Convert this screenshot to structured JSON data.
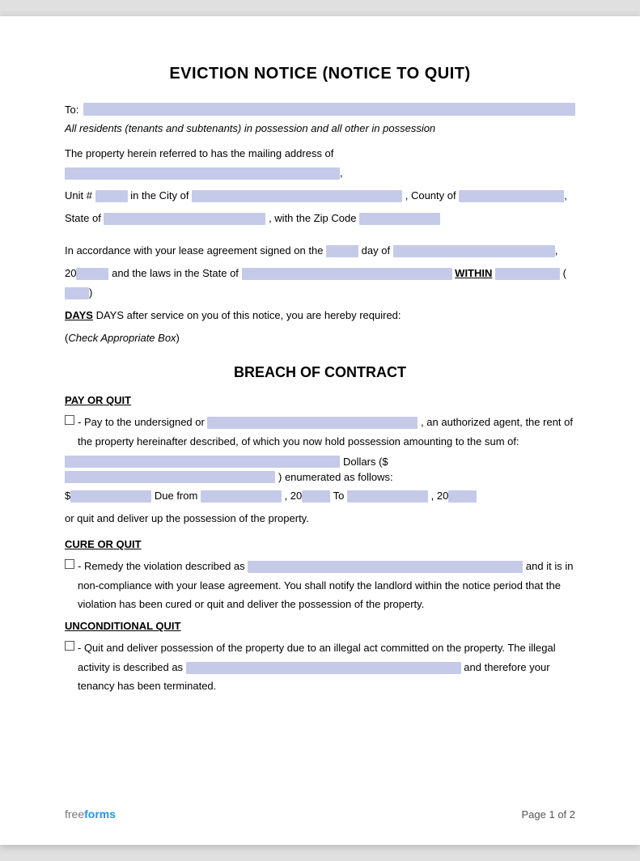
{
  "document": {
    "title": "EVICTION NOTICE (NOTICE TO QUIT)",
    "to_label": "To:",
    "italic_note": "All residents (tenants and subtenants) in possession and all other in possession",
    "address_intro": "The property herein referred to has the mailing address of",
    "unit_label": "Unit #",
    "city_label": "in the City of",
    "county_label": ", County of",
    "state_label": "State of",
    "zip_label": ", with the Zip Code",
    "lease_paragraph_1": "In accordance with your lease agreement signed on the",
    "lease_day": "day of",
    "lease_20": "20",
    "lease_and_laws": "and the laws in the State of",
    "lease_within": "WITHIN",
    "lease_days_text": "DAYS after service on you of this notice, you are hereby required:",
    "check_box_note": "(Check Appropriate Box)",
    "section_title": "BREACH OF CONTRACT",
    "pay_or_quit_label": "PAY OR QUIT",
    "pay_or_quit_text_1": "- Pay to the undersigned or",
    "pay_or_quit_text_2": ", an authorized agent, the rent of the property hereinafter described, of which you now hold possession amounting to the sum of:",
    "dollars_label": "Dollars ($",
    "dollars_close": ") enumerated as follows:",
    "due_from_label": "$",
    "due_from_text": "Due from",
    "due_comma_1": ", 20",
    "to_label_2": "To",
    "due_comma_2": ", 20",
    "quit_deliver": "or quit and deliver up the possession of the property.",
    "cure_or_quit_label": "CURE OR QUIT",
    "cure_text_1": "- Remedy the violation described as",
    "cure_text_2": "and it is in non-compliance with your lease agreement. You shall notify the landlord within the notice period that the violation has been cured or quit and deliver the possession of the property.",
    "unconditional_quit_label": "UNCONDITIONAL QUIT",
    "unconditional_text_1": "- Quit and deliver possession of the property due to an illegal act committed on the property. The illegal activity is described as",
    "unconditional_text_2": "and therefore your tenancy has been terminated.",
    "footer_brand_free": "free",
    "footer_brand_forms": "forms",
    "footer_page": "Page 1 of 2"
  }
}
